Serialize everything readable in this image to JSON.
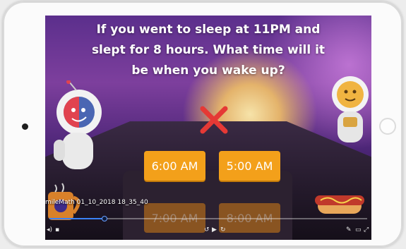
{
  "question": {
    "line1": "If you went to sleep at 11PM and",
    "line2": "slept for 8 hours. What time will it",
    "line3": "be when you wake up?"
  },
  "answers": [
    {
      "label": "6:00 AM",
      "state": "active"
    },
    {
      "label": "5:00 AM",
      "state": "active"
    },
    {
      "label": "7:00 AM",
      "state": "faded"
    },
    {
      "label": "8:00 AM",
      "state": "faded"
    }
  ],
  "feedback_icon": "wrong-x-icon",
  "video": {
    "filename": "mileMath 01_10_2018 18_35_40",
    "progress": 0.17
  },
  "colors": {
    "answer": "#f3a01a",
    "wrong": "#e53935",
    "progress": "#3b82f6"
  }
}
